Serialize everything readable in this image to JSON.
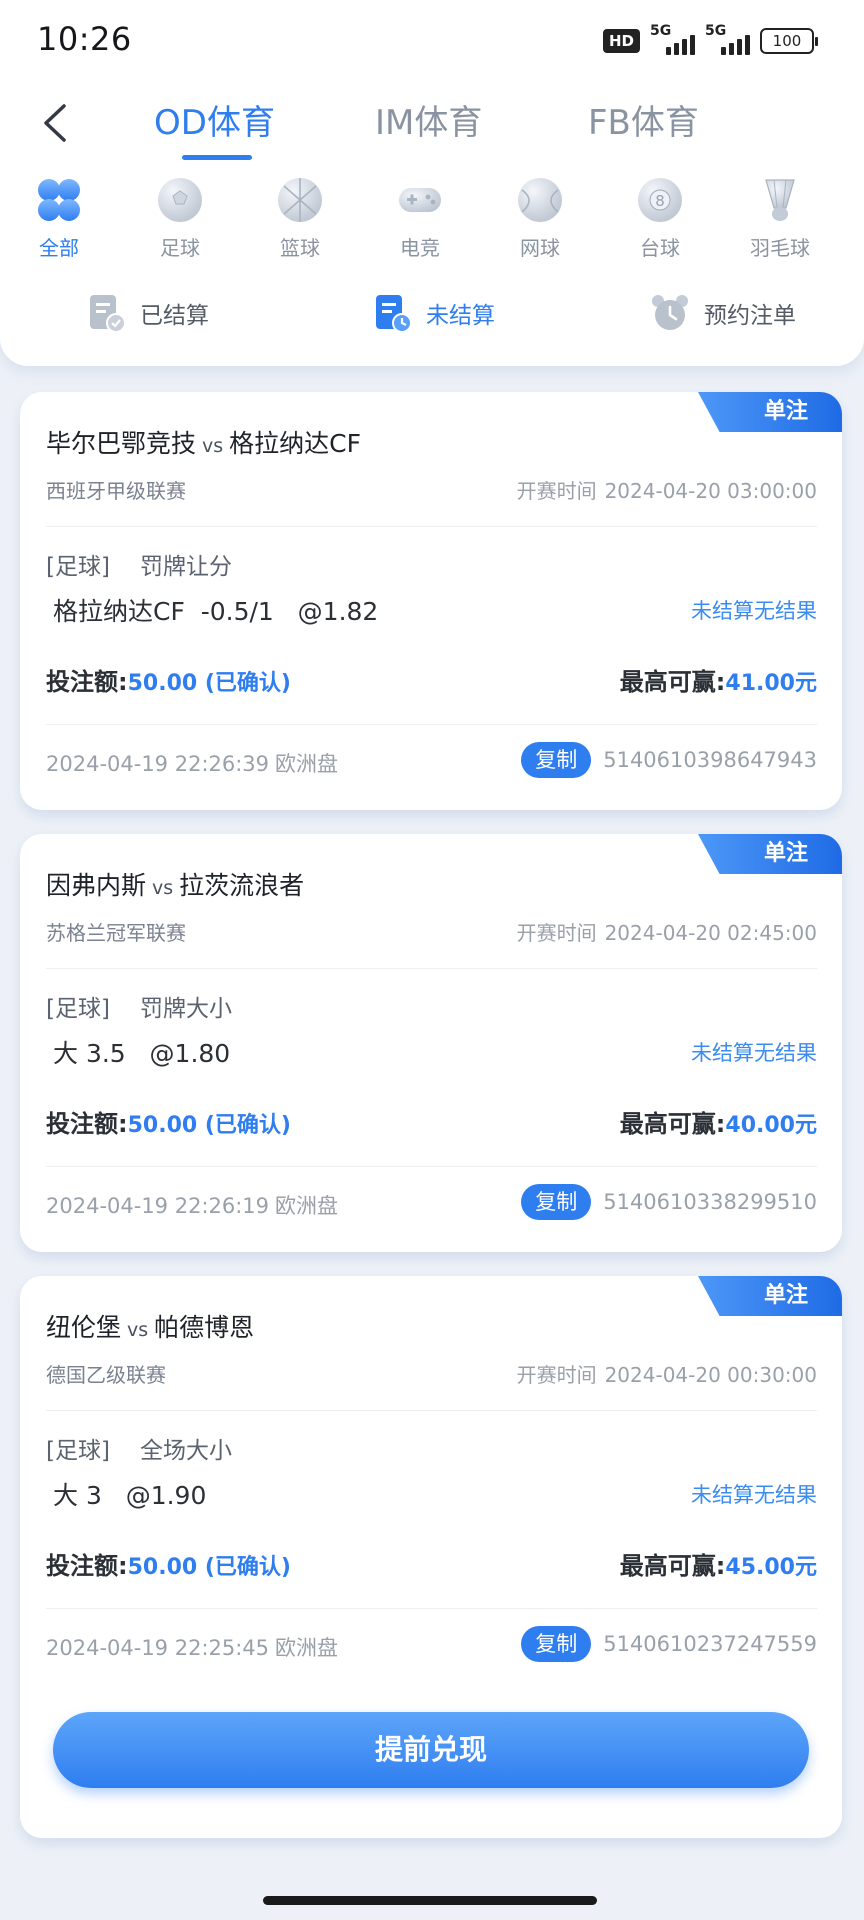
{
  "status_bar": {
    "time": "10:26",
    "hd": "HD",
    "net1": "5G",
    "net2": "5G",
    "battery": "100"
  },
  "top_tabs": [
    {
      "label": "OD体育"
    },
    {
      "label": "IM体育"
    },
    {
      "label": "FB体育"
    }
  ],
  "sports": [
    {
      "label": "全部",
      "icon": "all-clover-icon"
    },
    {
      "label": "足球",
      "icon": "soccer-ball-icon"
    },
    {
      "label": "篮球",
      "icon": "basketball-icon"
    },
    {
      "label": "电竞",
      "icon": "gamepad-icon"
    },
    {
      "label": "网球",
      "icon": "tennis-ball-icon"
    },
    {
      "label": "台球",
      "icon": "billiard-ball-icon"
    },
    {
      "label": "羽毛球",
      "icon": "shuttlecock-icon"
    }
  ],
  "status_tabs": [
    {
      "label": "已结算"
    },
    {
      "label": "未结算"
    },
    {
      "label": "预约注单"
    }
  ],
  "labels": {
    "vs": "vs",
    "start_time": "开赛时间",
    "stake": "投注额:",
    "max_win": "最高可赢:",
    "copy": "复制",
    "cashout": "提前兑现"
  },
  "bets": [
    {
      "badge": "单注",
      "home": "毕尔巴鄂竞技",
      "away": "格拉纳达CF",
      "league": "西班牙甲级联赛",
      "start": "2024-04-20 03:00:00",
      "sport": "[足球]",
      "market": "罚牌让分",
      "selection": "格拉纳达CF  -0.5/1   @1.82",
      "result": "未结算无结果",
      "stake": "50.00 (已确认)",
      "max_win": "41.00元",
      "placed": "2024-04-19 22:26:39",
      "odds_type": "欧洲盘",
      "order_id": "5140610398647943"
    },
    {
      "badge": "单注",
      "home": "因弗内斯",
      "away": "拉茨流浪者",
      "league": "苏格兰冠军联赛",
      "start": "2024-04-20 02:45:00",
      "sport": "[足球]",
      "market": "罚牌大小",
      "selection": "大 3.5   @1.80",
      "result": "未结算无结果",
      "stake": "50.00 (已确认)",
      "max_win": "40.00元",
      "placed": "2024-04-19 22:26:19",
      "odds_type": "欧洲盘",
      "order_id": "5140610338299510"
    },
    {
      "badge": "单注",
      "home": "纽伦堡",
      "away": "帕德博恩",
      "league": "德国乙级联赛",
      "start": "2024-04-20 00:30:00",
      "sport": "[足球]",
      "market": "全场大小",
      "selection": "大 3   @1.90",
      "result": "未结算无结果",
      "stake": "50.00 (已确认)",
      "max_win": "45.00元",
      "placed": "2024-04-19 22:25:45",
      "odds_type": "欧洲盘",
      "order_id": "5140610237247559"
    }
  ],
  "colors": {
    "accent": "#2f7ef0",
    "background": "#edf1f7",
    "muted": "#9aa0aa"
  }
}
